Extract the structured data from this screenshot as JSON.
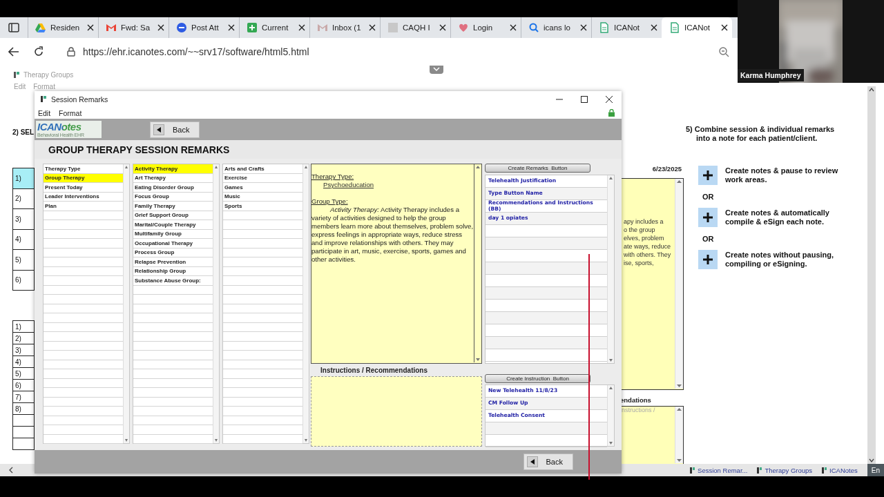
{
  "browser": {
    "tabs": [
      {
        "title": "Residen",
        "selected": false
      },
      {
        "title": "Fwd: Sa",
        "selected": false
      },
      {
        "title": "Post Att",
        "selected": false
      },
      {
        "title": "Current",
        "selected": false
      },
      {
        "title": "Inbox (1",
        "selected": false
      },
      {
        "title": "CAQH I",
        "selected": false
      },
      {
        "title": "Login",
        "selected": false
      },
      {
        "title": "icans lo",
        "selected": false
      },
      {
        "title": "ICANot",
        "selected": false
      },
      {
        "title": "ICANot",
        "selected": true
      }
    ],
    "url": "https://ehr.icanotes.com/~~srv17/software/html5.html"
  },
  "video_tile": {
    "name": "Karma Humphrey"
  },
  "background_window": {
    "title": "Therapy Groups",
    "menu": [
      "Edit",
      "Format"
    ],
    "section_label": "2) SEL",
    "patient_rows": [
      {
        "label": "1)",
        "selected": true
      },
      {
        "label": "2)",
        "selected": false
      },
      {
        "label": "3)",
        "selected": false
      },
      {
        "label": "4)",
        "selected": false
      },
      {
        "label": "5)",
        "selected": false
      },
      {
        "label": "6)",
        "selected": false
      }
    ],
    "remark_rows": [
      "1)",
      "2)",
      "3)",
      "4)",
      "5)",
      "6)",
      "7)",
      "8)"
    ],
    "step_heading": [
      "5) Combine session & individual remarks",
      "into a note for each patient/client."
    ],
    "date": "6/23/2025",
    "remarks_text_lines": [
      "apy includes a",
      "o the group",
      "elves, problem",
      "ate ways, reduce",
      "with others. They",
      "ise, sports,"
    ],
    "instructions_label": "endations",
    "instructions_placeholder": "nstructions /",
    "actions": [
      {
        "lines": [
          "Create notes & pause to review",
          "work areas."
        ]
      },
      {
        "lines": [
          "Create notes & automatically",
          "compile & eSign each note."
        ]
      },
      {
        "lines": [
          "Create notes without pausing,",
          "compiling or eSigning."
        ]
      }
    ],
    "separators": [
      "OR",
      "OR"
    ]
  },
  "dialog": {
    "title": "Session Remarks",
    "menu": [
      "Edit",
      "Format"
    ],
    "logo": "ICANotes",
    "logo_tagline": "Behavioral Health EHR",
    "back_top": "Back",
    "heading": "GROUP THERAPY SESSION REMARKS",
    "lists": [
      {
        "items": [
          {
            "label": "Therapy Type",
            "selected": false
          },
          {
            "label": "Group Therapy",
            "selected": true
          },
          {
            "label": "Present Today",
            "selected": false
          },
          {
            "label": "Leader Interventions",
            "selected": false
          },
          {
            "label": "Plan",
            "selected": false
          }
        ]
      },
      {
        "items": [
          {
            "label": "Activity Therapy",
            "selected": true
          },
          {
            "label": "Art Therapy",
            "selected": false
          },
          {
            "label": "Eating Disorder Group",
            "selected": false
          },
          {
            "label": "Focus Group",
            "selected": false
          },
          {
            "label": "Family Therapy",
            "selected": false
          },
          {
            "label": "Grief Support Group",
            "selected": false
          },
          {
            "label": "Marital/Couple Therapy",
            "selected": false
          },
          {
            "label": "Multifamily Group",
            "selected": false
          },
          {
            "label": "Occupational Therapy",
            "selected": false
          },
          {
            "label": "Process Group",
            "selected": false
          },
          {
            "label": "Relapse Prevention",
            "selected": false
          },
          {
            "label": "Relationship Group",
            "selected": false
          },
          {
            "label": "Substance Abuse Group:",
            "selected": false
          }
        ]
      },
      {
        "items": [
          {
            "label": "Arts and Crafts",
            "selected": false
          },
          {
            "label": "Exercise",
            "selected": false
          },
          {
            "label": "Games",
            "selected": false
          },
          {
            "label": "Music",
            "selected": false
          },
          {
            "label": "Sports",
            "selected": false
          }
        ]
      }
    ],
    "note": {
      "heading_1": "Therapy Type:",
      "value_1": "Psychoeducation",
      "heading_2": "Group Type:",
      "body": "*Activity Therapy:* Activity Therapy includes a variety of activities designed to help the group members learn more about themselves, problem solve, express feelings in appropriate ways, reduce stress and improve relationships with others. They may participate in art, music, exercise, sports, games and other activities."
    },
    "remarks_button": "Create Remarks  Button",
    "remark_buttons": [
      "Telehealth Justification",
      "Type Button Name",
      "Recommendations and Instructions (BB)",
      "day 1 opiates"
    ],
    "instructions_label": "Instructions / Recommendations",
    "instruction_button": "Create Instruction  Button",
    "instruction_buttons": [
      "New Telehealth 11/8/23",
      "CM Follow Up",
      "Telehealth Consent"
    ],
    "back_bottom": "Back"
  },
  "taskbar": {
    "items": [
      "Session Remar...",
      "Therapy Groups",
      "ICANotes"
    ],
    "language": "En"
  }
}
